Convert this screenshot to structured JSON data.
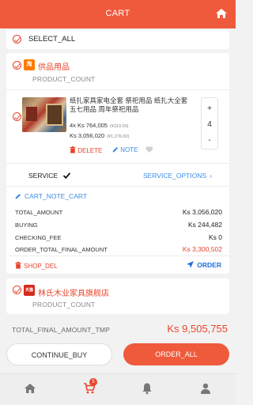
{
  "header": {
    "title": "CART",
    "home_icon": "home-icon"
  },
  "select_all": {
    "label": "SELECT_ALL"
  },
  "shops": [
    {
      "name": "供品用品",
      "logo_text": "淘",
      "product_count_label": "PRODUCT_COUNT",
      "item": {
        "title": "纸扎家具家电全套 祭祀用品 纸扎大全套 五七用品 周年祭祀用品",
        "qty_line": "4x  Ks 764,005",
        "qty_line_sub": "(¥319.00)",
        "price_line": "Ks 3,056,020",
        "price_line_sub": "(¥1,276.00)",
        "quantity": "4",
        "plus": "+",
        "minus": "-",
        "delete_label": "DELETE",
        "note_label": "NOTE"
      },
      "service_label": "SERVICE",
      "service_options_label": "SERVICE_OPTIONS",
      "cart_note_label": "CART_NOTE_CART",
      "summary": [
        {
          "key": "TOTAL_AMOUNT",
          "value": "Ks 3,056,020"
        },
        {
          "key": "BUYING",
          "value": "Ks 244,482"
        },
        {
          "key": "CHECKING_FEE",
          "value": "Ks 0"
        },
        {
          "key": "ORDER_TOTAL_FINAL_AMOUNT",
          "value": "Ks 3,300,502"
        }
      ],
      "shop_del_label": "SHOP_DEL",
      "order_label": "ORDER"
    },
    {
      "name": "林氏木业家具旗舰店",
      "logo_text": "天猫",
      "product_count_label": "PRODUCT_COUNT"
    }
  ],
  "footer": {
    "total_label": "TOTAL_FINAL_AMOUNT_TMP",
    "total_value": "Ks 9,505,755",
    "continue_label": "CONTINUE_BUY",
    "order_all_label": "ORDER_ALL"
  },
  "tabbar": {
    "cart_badge": "5"
  },
  "colors": {
    "accent": "#ef5a3c",
    "link": "#3d8ee6",
    "price_red": "#e8452c"
  }
}
